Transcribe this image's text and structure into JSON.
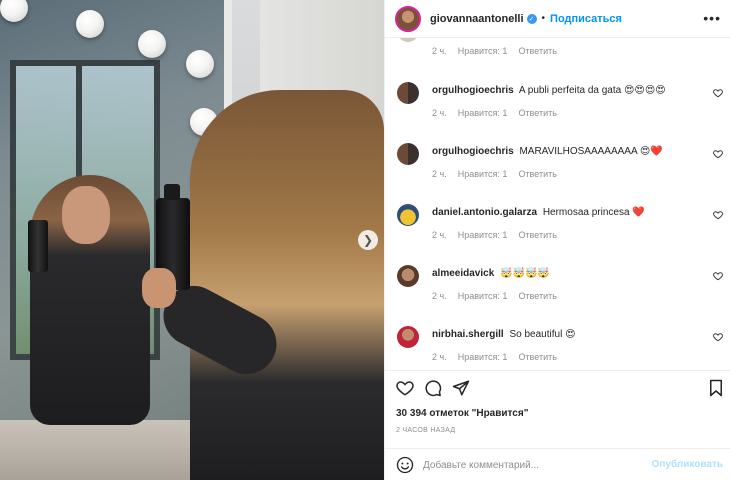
{
  "post": {
    "username": "giovannaantonelli",
    "verified_icon": "verified-badge-icon",
    "follow_label": "Подписаться",
    "more_icon": "more-options-icon"
  },
  "previous_comment": {
    "time": "2 ч.",
    "likes": "Нравится: 1",
    "reply": "Ответить"
  },
  "comments": [
    {
      "username": "orgulhogioechris",
      "text": "A publi perfeita da gata",
      "emoji": "😍😍😍😍",
      "time": "2 ч.",
      "likes": "Нравится: 1",
      "reply": "Ответить"
    },
    {
      "username": "orgulhogioechris",
      "text": "MARAVILHOSAAAAAAAA",
      "emoji": "😍❤️",
      "time": "2 ч.",
      "likes": "Нравится: 1",
      "reply": "Ответить"
    },
    {
      "username": "daniel.antonio.galarza",
      "text": "Hermosaa princesa",
      "emoji": "❤️",
      "time": "2 ч.",
      "likes": "Нравится: 1",
      "reply": "Ответить"
    },
    {
      "username": "almeeidavick",
      "text": "",
      "emoji": "🤯🤯🤯🤯",
      "time": "2 ч.",
      "likes": "Нравится: 1",
      "reply": "Ответить"
    },
    {
      "username": "nirbhai.shergill",
      "text": "So beautiful",
      "emoji": "😍",
      "time": "2 ч.",
      "likes": "Нравится: 1",
      "reply": "Ответить"
    }
  ],
  "likes_count": "30 394 отметок \"Нравится\"",
  "posted_time": "2 ЧАСОВ НАЗАД",
  "composer": {
    "placeholder": "Добавьте комментарий...",
    "publish_label": "Опубликовать"
  },
  "colors": {
    "accent": "#0095f6",
    "publish_disabled": "#b2dffc",
    "secondary_text": "#8e8e8e"
  }
}
